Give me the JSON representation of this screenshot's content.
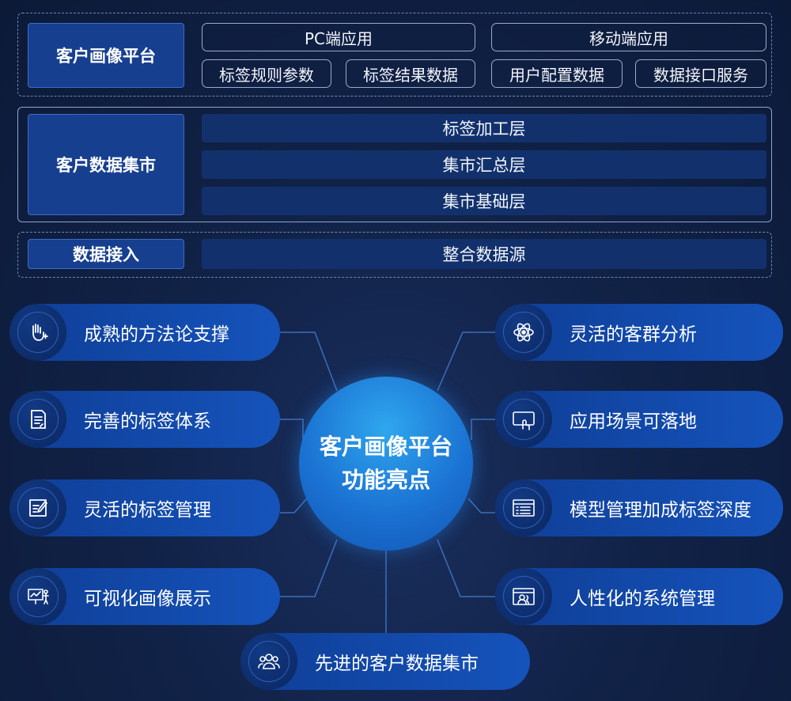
{
  "architecture": {
    "portal": {
      "label": "客户画像平台",
      "apps": [
        "PC端应用",
        "移动端应用"
      ],
      "modules": [
        "标签规则参数",
        "标签结果数据",
        "用户配置数据",
        "数据接口服务"
      ]
    },
    "mart": {
      "label": "客户数据集市",
      "layers": [
        "标签加工层",
        "集市汇总层",
        "集市基础层"
      ]
    },
    "ingest": {
      "label": "数据接入",
      "source": "整合数据源"
    }
  },
  "hub": {
    "line1": "客户画像平台",
    "line2": "功能亮点"
  },
  "features": {
    "left": [
      {
        "label": "成熟的方法论支撑",
        "icon": "hand-icon"
      },
      {
        "label": "完善的标签体系",
        "icon": "document-icon"
      },
      {
        "label": "灵活的标签管理",
        "icon": "edit-icon"
      },
      {
        "label": "可视化画像展示",
        "icon": "presentation-icon"
      }
    ],
    "right": [
      {
        "label": "灵活的客群分析",
        "icon": "atom-icon"
      },
      {
        "label": "应用场景可落地",
        "icon": "touch-screen-icon"
      },
      {
        "label": "模型管理加成标签深度",
        "icon": "list-window-icon"
      },
      {
        "label": "人性化的系统管理",
        "icon": "user-window-icon"
      }
    ],
    "bottom": {
      "label": "先进的客户数据集市",
      "icon": "users-icon"
    }
  },
  "colors": {
    "background": "#112247",
    "label_fill": "#173f8f",
    "bar_fill": "#12316c",
    "pill_fill": "#1553bb",
    "hub_fill": "#1b73d3",
    "line": "#3d6fb8"
  }
}
